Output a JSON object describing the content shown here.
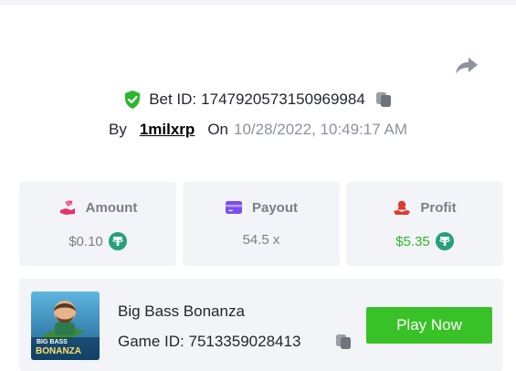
{
  "bet": {
    "id_label": "Bet ID:",
    "id_value": "1747920573150969984",
    "by_label": "By",
    "username": "1milxrp",
    "on_label": "On",
    "datetime": "10/28/2022, 10:49:17 AM"
  },
  "stats": [
    {
      "label": "Amount",
      "value": "$0.10",
      "icon": "bet-hand-icon",
      "currency_icon": "tether-icon"
    },
    {
      "label": "Payout",
      "value": "54.5 x",
      "icon": "card-icon"
    },
    {
      "label": "Profit",
      "value": "$5.35",
      "icon": "profit-hand-icon",
      "currency_icon": "tether-icon"
    }
  ],
  "game": {
    "title": "Big Bass Bonanza",
    "id_label": "Game ID:",
    "id_value": "7513359028413",
    "thumb_text_1": "BIG BASS",
    "thumb_text_2": "BONANZA",
    "play_label": "Play Now"
  },
  "colors": {
    "accent_green": "#39c227",
    "profit_green": "#2fb52f",
    "tether": "#26a17b",
    "card_bg": "#f3f4f7",
    "payout_purple": "#7b4cf0",
    "amount_pink": "#e5336a",
    "profit_red": "#e23a2f"
  }
}
